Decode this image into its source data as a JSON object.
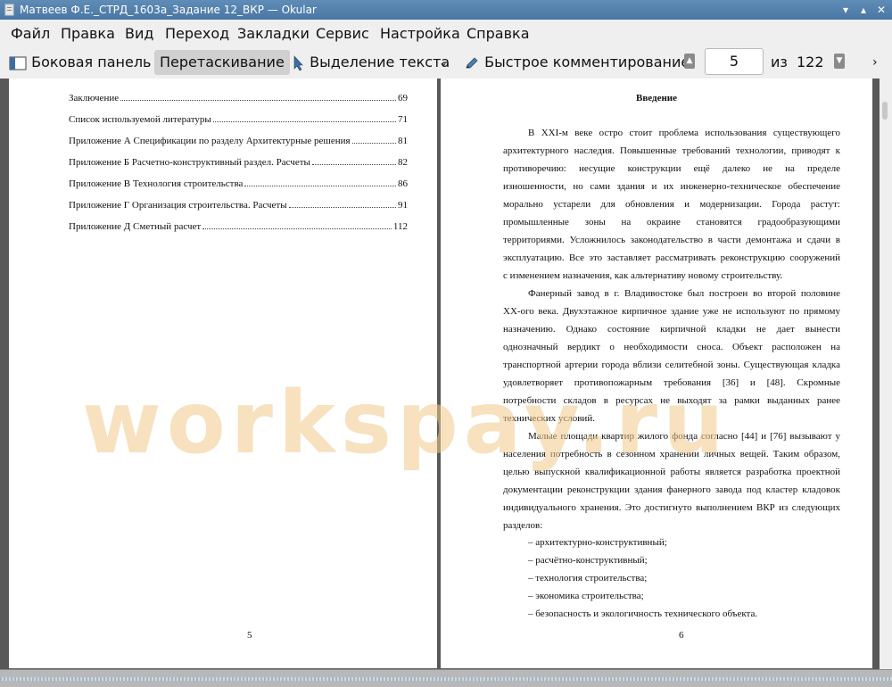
{
  "window": {
    "title": "Матвеев Ф.Е._СТРД_1603а_Задание 12_ВКР  — Okular",
    "controls": [
      "▾",
      "▴",
      "✕"
    ]
  },
  "menu": [
    "Файл",
    "Правка",
    "Вид",
    "Переход",
    "Закладки",
    "Сервис",
    "Настройка",
    "Справка"
  ],
  "toolbar": {
    "sidebar": "Боковая панель",
    "drag": "Перетаскивание",
    "text_select": "Выделение текста",
    "quick_annotate": "Быстрое комментирование",
    "page_current": "5",
    "page_of": "из",
    "page_total": "122"
  },
  "left_page": {
    "toc": [
      {
        "title": "Заключение",
        "page": "69"
      },
      {
        "title": "Список используемой литературы",
        "page": "71"
      },
      {
        "title": "Приложение А Спецификации по разделу Архитектурные решения",
        "page": "81"
      },
      {
        "title": "Приложение Б Расчетно-конструктивный раздел. Расчеты",
        "page": "82"
      },
      {
        "title": "Приложение В Технология строительства",
        "page": "86"
      },
      {
        "title": "Приложение Г Организация строительства. Расчеты",
        "page": "91"
      },
      {
        "title": "Приложение Д Сметный расчет",
        "page": "112"
      }
    ],
    "page_number": "5"
  },
  "right_page": {
    "heading": "Введение",
    "lines": [
      "В XXI-м веке остро стоит проблема использования существующего",
      "архитектурного наследия. Повышенные требований технологии, приводят к",
      "противоречию: несущие конструкции ещё далеко не на пределе",
      "изношенности, но сами здания и их инженерно-техническое обеспечение",
      "морально устарели для обновления и модернизации. Города растут:",
      "промышленные зоны на окраине становятся градообразующими",
      "территориями. Усложнилось законодательство в части демонтажа и сдачи в",
      "эксплуатацию. Все это заставляет рассматривать реконструкцию сооружений",
      "с изменением назначения, как альтернативу новому строительству.",
      "Фанерный завод в г. Владивостоке был построен во второй половине",
      "XX-ого века. Двухэтажное кирпичное здание уже не используют по прямому",
      "назначению. Однако состояние кирпичной кладки не дает вынести",
      "однозначный вердикт о необходимости сноса. Объект расположен на",
      "транспортной артерии города вблизи селитебной зоны. Существующая кладка",
      "удовлетворяет противопожарным требования [36] и [48]. Скромные",
      "потребности складов в ресурсах не выходят за рамки выданных ранее",
      "технических условий.",
      "Малые площади квартир жилого фонда согласно [44] и [76] вызывают у",
      "населения потребность в сезонном хранении личных вещей. Таким образом,",
      "целью выпускной квалификационной работы является разработка проектной",
      "документации реконструкции здания фанерного завода под кластер кладовок",
      "индивидуального хранения. Это достигнуто выполнением ВКР из следующих",
      "разделов:"
    ],
    "bullets": [
      "–  архитектурно-конструктивный;",
      "–  расчётно-конструктивный;",
      "–  технология строительства;",
      "–  экономика строительства;",
      "–  безопасность и экологичность технического объекта."
    ],
    "page_number": "6"
  },
  "watermark": "workspay.ru"
}
